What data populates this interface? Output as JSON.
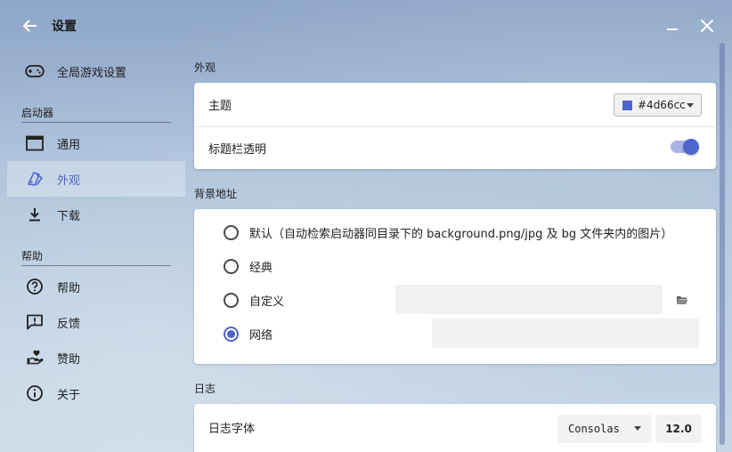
{
  "window": {
    "title": "设置"
  },
  "sidebar": {
    "global_games": "全局游戏设置",
    "section_launcher": "启动器",
    "general": "通用",
    "appearance": "外观",
    "download": "下载",
    "section_help": "帮助",
    "help": "帮助",
    "feedback": "反馈",
    "sponsor": "赞助",
    "about": "关于"
  },
  "appearance": {
    "title": "外观",
    "theme_label": "主题",
    "theme_value": "#4d66cc",
    "theme_color": "#4d66cc",
    "titlebar_transparent_label": "标题栏透明",
    "titlebar_transparent_on": true
  },
  "background": {
    "title": "背景地址",
    "opt_default": "默认（自动检索启动器同目录下的 background.png/jpg 及 bg 文件夹内的图片）",
    "opt_classic": "经典",
    "opt_custom": "自定义",
    "opt_network": "网络",
    "custom_path_value": "",
    "network_url_value": "",
    "selected": "network"
  },
  "log": {
    "title": "日志",
    "font_label": "日志字体",
    "font_value": "Consolas",
    "font_size": "12.0"
  },
  "colors": {
    "accent": "#4d66cc"
  }
}
